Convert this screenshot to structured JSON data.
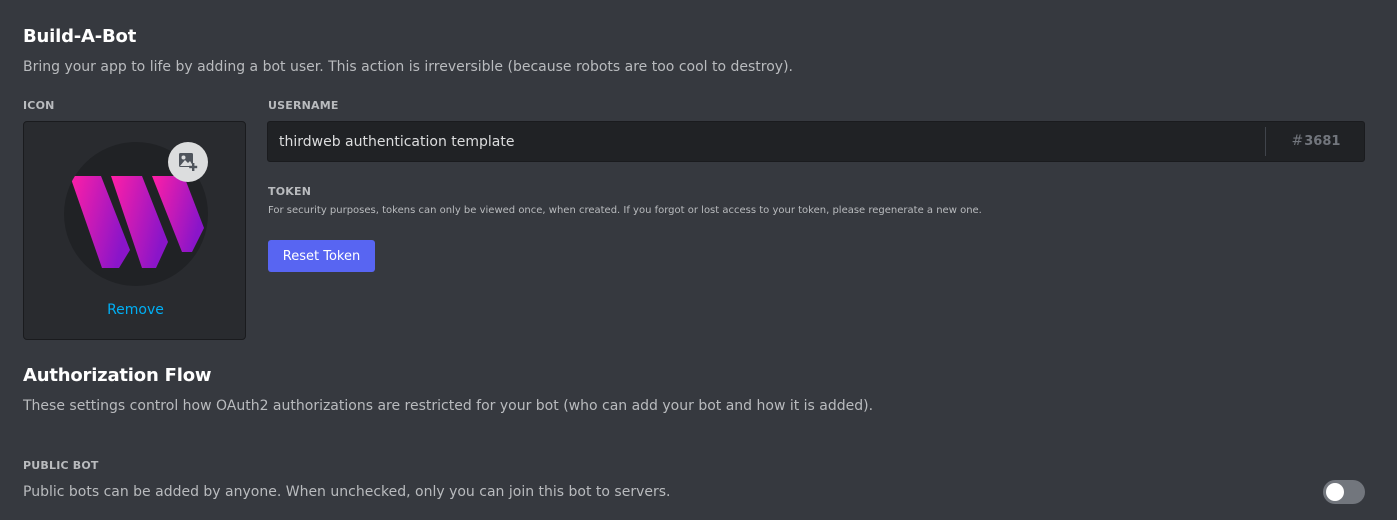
{
  "build_a_bot": {
    "title": "Build-A-Bot",
    "description": "Bring your app to life by adding a bot user. This action is irreversible (because robots are too cool to destroy).",
    "icon_label": "ICON",
    "remove_label": "Remove",
    "username_label": "USERNAME",
    "username_value": "thirdweb authentication template",
    "discriminator_hash": "#",
    "discriminator": "3681",
    "token_label": "TOKEN",
    "token_help": "For security purposes, tokens can only be viewed once, when created. If you forgot or lost access to your token, please regenerate a new one.",
    "reset_token_label": "Reset Token"
  },
  "authorization_flow": {
    "title": "Authorization Flow",
    "description": "These settings control how OAuth2 authorizations are restricted for your bot (who can add your bot and how it is added).",
    "public_bot_label": "PUBLIC BOT",
    "public_bot_description": "Public bots can be added by anyone. When unchecked, only you can join this bot to servers.",
    "public_bot_enabled": false
  },
  "icons": {
    "upload": "image-add-icon",
    "logo": "thirdweb-logo"
  },
  "colors": {
    "background": "#36393f",
    "accent": "#5865f2",
    "link": "#00aff4",
    "logo_gradient_start": "#ff1fa6",
    "logo_gradient_end": "#8a15c9"
  }
}
